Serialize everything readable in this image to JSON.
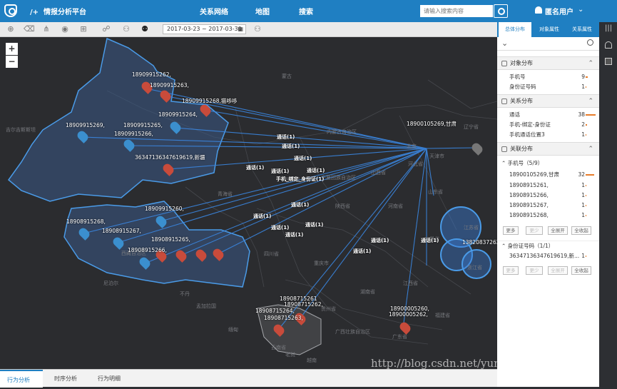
{
  "app": {
    "title": "情报分析平台",
    "logo_glyph": "/+"
  },
  "nav": [
    "关系网络",
    "地图",
    "搜索"
  ],
  "search": {
    "placeholder": "请输入搜索内容"
  },
  "user": {
    "name": "匿名用户"
  },
  "toolbar": {
    "date_range": "2017-03-23 ~ 2017-03-30"
  },
  "map": {
    "zoom_in": "+",
    "zoom_out": "−",
    "places": [
      "吉尔吉斯斯坦",
      "蒙古",
      "内蒙古自治区",
      "辽宁省",
      "北京",
      "天津市",
      "河北省",
      "山西省",
      "青海省",
      "甘肃省",
      "宁夏回族自治区",
      "陕西省",
      "河南省",
      "山东省",
      "江苏省",
      "安徽省",
      "湖北省",
      "西藏自治区",
      "四川省",
      "重庆市",
      "浙江省",
      "湖南省",
      "江西省",
      "贵州省",
      "云南省",
      "广西壮族自治区",
      "广东省",
      "福建省",
      "尼泊尔",
      "不丹",
      "孟加拉国",
      "缅甸",
      "老挝",
      "越南"
    ],
    "nodes": [
      "18909915262,",
      "18909915263,",
      "18909915268,猫哆哆",
      "18909915264,",
      "18909915269,",
      "18909915265,",
      "18909915266,",
      "36347136347619619,新疆",
      "18900105269,甘肃",
      "18909915260,",
      "18908915268,",
      "18908915267,",
      "18908915265,",
      "18908915266,",
      "18908715261",
      "18908715262,",
      "18908715264,",
      "18908715263,",
      "18900005260,",
      "18900005262,",
      "13820837262,"
    ],
    "edge_label": "通话(1)",
    "edge_label_bind": "手机_绑定_身份证(1)"
  },
  "bottom_tabs": [
    "行为分析",
    "时序分析",
    "行为明细"
  ],
  "watermark": "http://blog.csdn.net/yunqiinsight",
  "sidebar": {
    "tabs": [
      "总体分布",
      "对象属性",
      "关系属性"
    ],
    "object_dist": {
      "title": "对象分布",
      "rows": [
        {
          "name": "手机号",
          "count": "9"
        },
        {
          "name": "身份证号码",
          "count": "1"
        }
      ]
    },
    "relation_dist": {
      "title": "关系分布",
      "rows": [
        {
          "name": "通话",
          "count": "38"
        },
        {
          "name": "手机-绑定-身份证",
          "count": "2"
        },
        {
          "name": "手机通话位置3",
          "count": "1"
        }
      ]
    },
    "link_dist": {
      "title": "关联分布",
      "phone_group": {
        "label": "手机号（5/9）",
        "rows": [
          {
            "name": "18900105269,甘肃",
            "count": "32"
          },
          {
            "name": "18908915261,",
            "count": "1"
          },
          {
            "name": "18908915266,",
            "count": "1"
          },
          {
            "name": "18908915267,",
            "count": "1"
          },
          {
            "name": "18908915268,",
            "count": "1"
          }
        ]
      },
      "id_group": {
        "label": "身份证号码（1/1）",
        "rows": [
          {
            "name": "36347136347619619,新...",
            "count": "1"
          }
        ]
      }
    },
    "buttons": [
      "更多",
      "更少",
      "全展开",
      "全收起"
    ]
  },
  "colors": {
    "accent": "#1f7fc2",
    "bar": "#e87c2a",
    "map_bg": "#2b2c2f",
    "region": "#3a5a86"
  }
}
